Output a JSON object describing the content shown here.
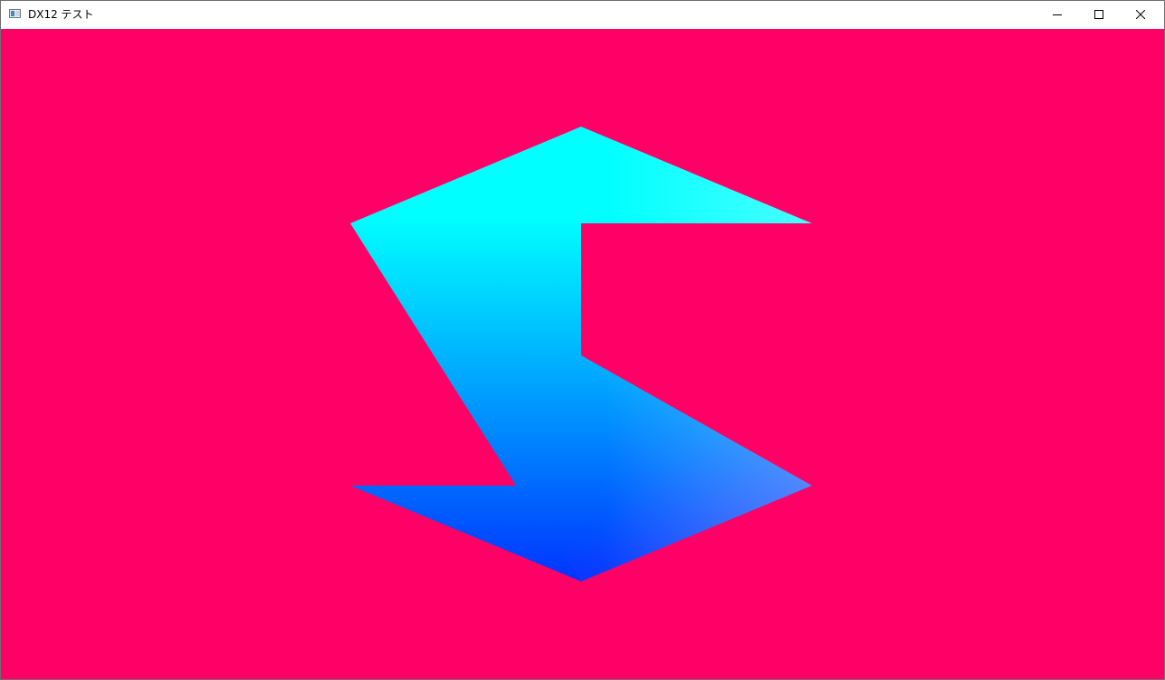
{
  "window": {
    "title": "DX12 テスト",
    "controls": {
      "minimize": "minimize-icon",
      "maximize": "maximize-icon",
      "close": "close-icon"
    }
  },
  "render": {
    "clear_color": "#FF0066",
    "gradient_top": "#00FFFF",
    "gradient_bottom": "#0033FF",
    "gradient_right": "#5566FF"
  }
}
